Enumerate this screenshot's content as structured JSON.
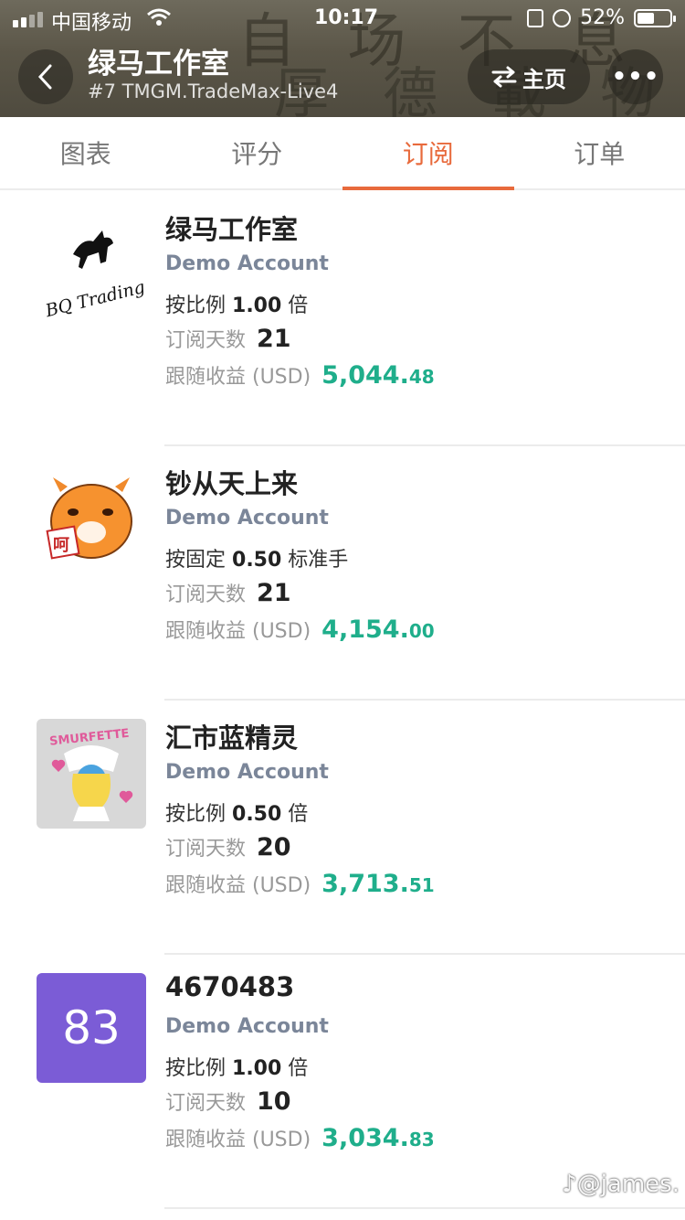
{
  "status_bar": {
    "carrier": "中国移动",
    "time": "10:17",
    "battery": "52%"
  },
  "header": {
    "title": "绿马工作室",
    "subtitle": "#7 TMGM.TradeMax-Live4",
    "home_label": "主页"
  },
  "tabs": [
    {
      "label": "图表",
      "active": false
    },
    {
      "label": "评分",
      "active": false
    },
    {
      "label": "订阅",
      "active": true
    },
    {
      "label": "订单",
      "active": false
    }
  ],
  "labels": {
    "days": "订阅天数",
    "profit": "跟随收益 (USD)"
  },
  "subscriptions": [
    {
      "name": "绿马工作室",
      "account": "Demo Account",
      "mode_prefix": "按比例",
      "mode_value": "1.00",
      "mode_suffix": "倍",
      "days": "21",
      "profit_int": "5,044.",
      "profit_dec": "48",
      "avatar_text": "BQ Trading"
    },
    {
      "name": "钞从天上来",
      "account": "Demo Account",
      "mode_prefix": "按固定",
      "mode_value": "0.50",
      "mode_suffix": "标准手",
      "days": "21",
      "profit_int": "4,154.",
      "profit_dec": "00",
      "avatar_text": "呵"
    },
    {
      "name": "汇市蓝精灵",
      "account": "Demo Account",
      "mode_prefix": "按比例",
      "mode_value": "0.50",
      "mode_suffix": "倍",
      "days": "20",
      "profit_int": "3,713.",
      "profit_dec": "51",
      "avatar_text": "SMURFETTE"
    },
    {
      "name": "4670483",
      "account": "Demo Account",
      "mode_prefix": "按比例",
      "mode_value": "1.00",
      "mode_suffix": "倍",
      "days": "10",
      "profit_int": "3,034.",
      "profit_dec": "83",
      "avatar_text": "83"
    }
  ],
  "watermark": "@james.",
  "colors": {
    "accent": "#e86a3c",
    "profit": "#1fae8b",
    "account": "#7b8699",
    "avatar_purple": "#7b5cd6"
  }
}
